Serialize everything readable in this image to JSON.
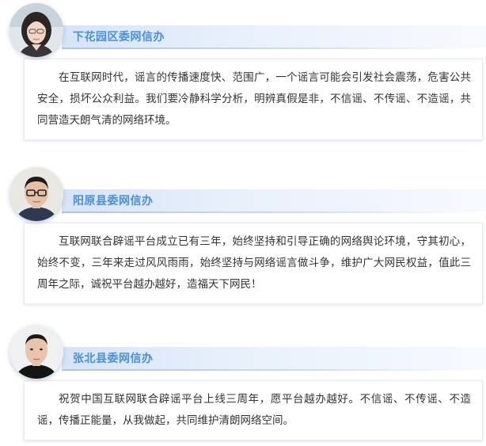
{
  "entries": [
    {
      "name": "下花园区委网信办",
      "text": "在互联网时代，谣言的传播速度快、范围广，一个谣言可能会引发社会震荡，危害公共安全，损坏公众利益。我们要冷静科学分析，明辨真假是非，不信谣、不传谣、不造谣，共同营造天朗气清的网络环境。",
      "avatar_icon": "woman-portrait"
    },
    {
      "name": "阳原县委网信办",
      "text": "互联网联合辟谣平台成立已有三年，始终坚持和引导正确的网络舆论环境，守其初心，始终不变，三年来走过风风雨雨，始终坚持与网络谣言做斗争，维护广大网民权益，值此三周年之际，诚祝平台越办越好，造福天下网民！",
      "avatar_icon": "man-with-glasses-portrait"
    },
    {
      "name": "张北县委网信办",
      "text": "祝贺中国互联网联合辟谣平台上线三周年，愿平台越办越好。不信谣、不传谣、不造谣，传播正能量，从我做起，共同维护清朗网络空间。",
      "avatar_icon": "man-portrait"
    }
  ],
  "colors": {
    "name_text": "#4a8fd8",
    "name_bar": "#d6e4f7",
    "body_text": "#333333",
    "card_border": "#e6ebf2"
  }
}
